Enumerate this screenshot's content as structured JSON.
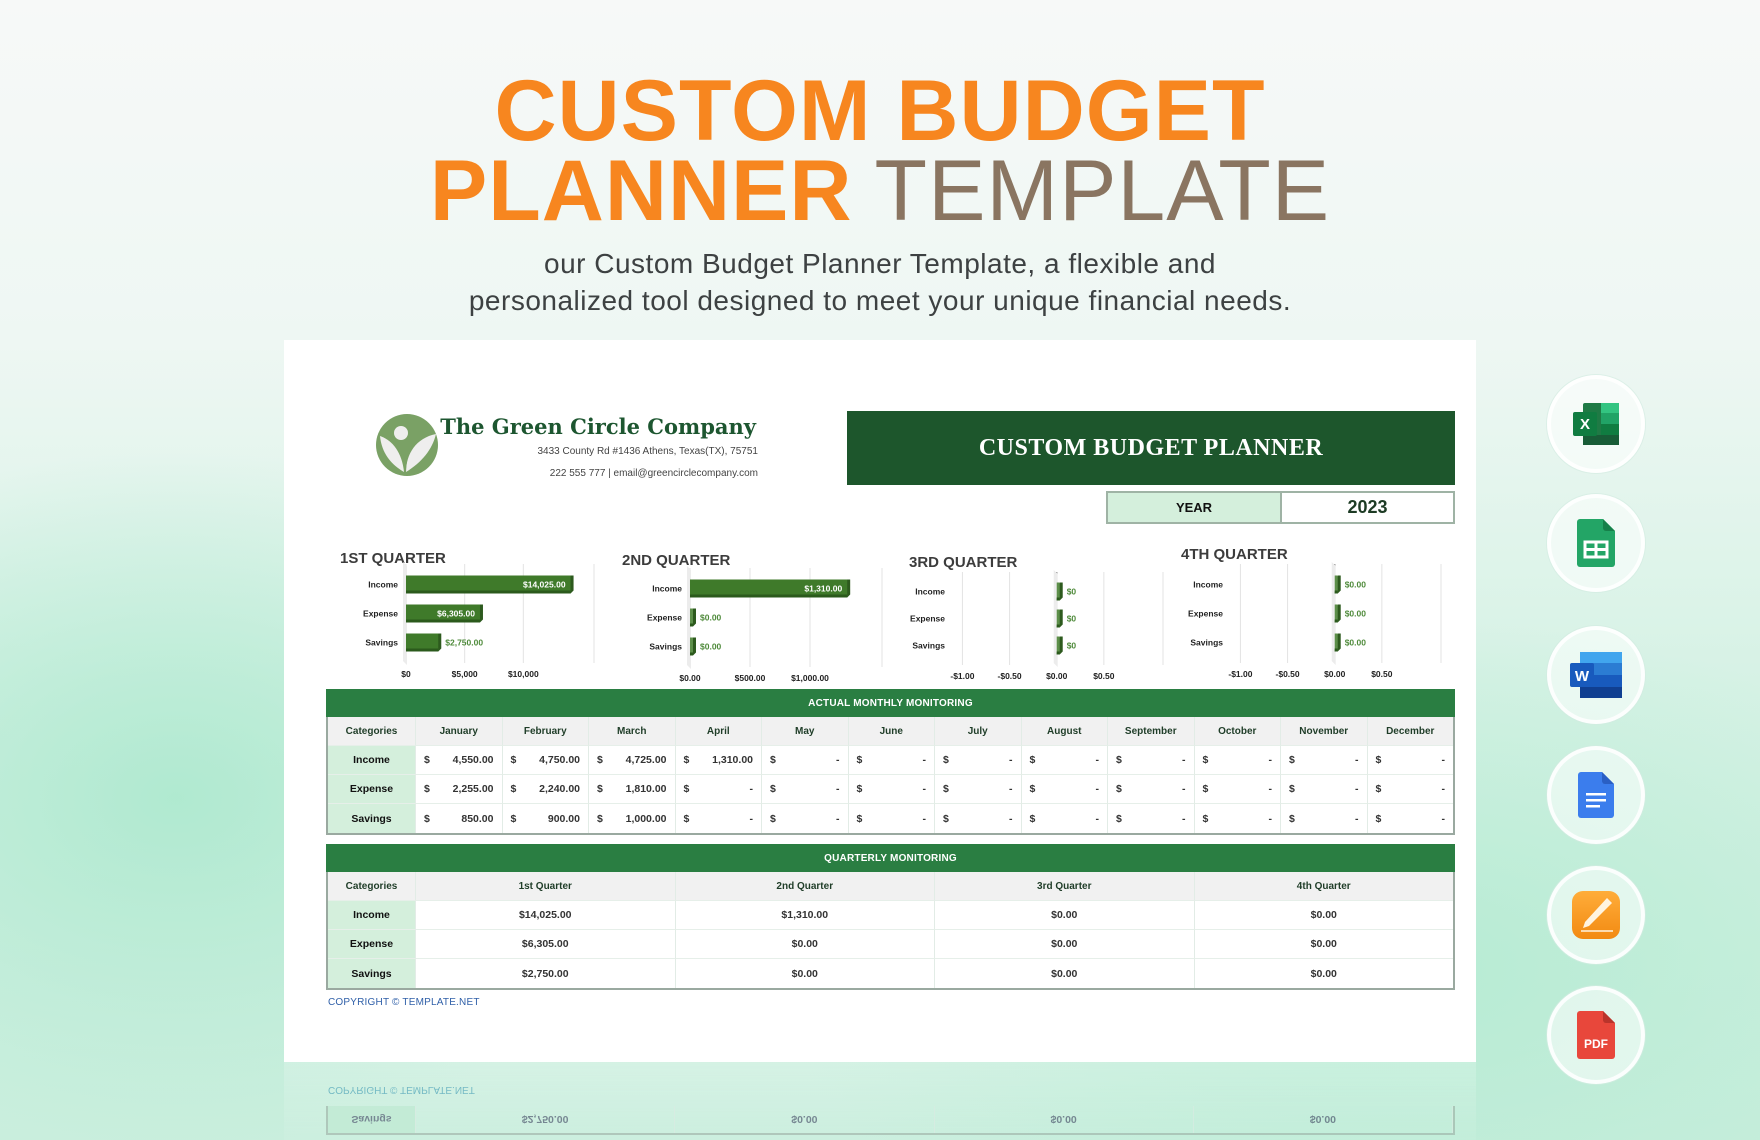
{
  "hero": {
    "title_line1": "CUSTOM BUDGET",
    "title_line2_accent": "PLANNER",
    "title_line2_muted": "TEMPLATE",
    "subtitle_line1": "our Custom Budget Planner Template, a flexible and",
    "subtitle_line2": "personalized tool designed to meet your unique financial needs."
  },
  "company": {
    "name": "The Green Circle Company",
    "address": "3433 County Rd #1436 Athens, Texas(TX), 75751",
    "contact": "222 555 777  |  email@greencirclecompany.com",
    "logo_icon": "leaf-sprout-logo-icon"
  },
  "banner": {
    "title": "CUSTOM BUDGET PLANNER",
    "year_label": "YEAR",
    "year_value": "2023"
  },
  "colors": {
    "brand_dark_green": "#1d562c",
    "table_header_green": "#2a7e42",
    "category_cell_mint": "#d4efdc",
    "bar_green": "#3f7a2a",
    "hero_orange": "#f7861f",
    "hero_brown": "#8a7561",
    "copyright_blue": "#2f5fa8"
  },
  "chart_data": [
    {
      "type": "bar",
      "orientation": "horizontal",
      "title": "1ST QUARTER",
      "categories": [
        "Income",
        "Expense",
        "Savings"
      ],
      "values": [
        14025,
        6305,
        2750
      ],
      "value_labels": [
        "$14,025.00",
        "$6,305.00",
        "$2,750.00"
      ],
      "xlim": [
        0,
        15000
      ],
      "xticks": [
        0,
        5000,
        10000
      ],
      "xtick_labels": [
        "$0",
        "$5,000",
        "$10,000"
      ],
      "grid": true
    },
    {
      "type": "bar",
      "orientation": "horizontal",
      "title": "2ND QUARTER",
      "categories": [
        "Income",
        "Expense",
        "Savings"
      ],
      "values": [
        1310,
        0,
        0
      ],
      "value_labels": [
        "$1,310.00",
        "$0.00",
        "$0.00"
      ],
      "xlim": [
        0,
        1500
      ],
      "xticks": [
        0,
        500,
        1000
      ],
      "xtick_labels": [
        "$0.00",
        "$500.00",
        "$1,000.00"
      ],
      "grid": true
    },
    {
      "type": "bar",
      "orientation": "horizontal",
      "title": "3RD QUARTER",
      "categories": [
        "Income",
        "Expense",
        "Savings"
      ],
      "values": [
        0,
        0,
        0
      ],
      "value_labels": [
        "$0",
        "$0",
        "$0"
      ],
      "xlim": [
        -1.1,
        1.0
      ],
      "xticks": [
        -1.0,
        -0.5,
        0,
        0.5
      ],
      "xtick_labels": [
        "-$1.00",
        "-$0.50",
        "$0.00",
        "$0.50"
      ],
      "grid": true
    },
    {
      "type": "bar",
      "orientation": "horizontal",
      "title": "4TH QUARTER",
      "categories": [
        "Income",
        "Expense",
        "Savings"
      ],
      "values": [
        0,
        0,
        0
      ],
      "value_labels": [
        "$0.00",
        "$0.00",
        "$0.00"
      ],
      "xlim": [
        -1.1,
        1.0
      ],
      "xticks": [
        -1.0,
        -0.5,
        0,
        0.5
      ],
      "xtick_labels": [
        "-$1.00",
        "-$0.50",
        "$0.00",
        "$0.50"
      ],
      "grid": true
    }
  ],
  "monthly": {
    "title": "ACTUAL MONTHLY MONITORING",
    "category_header": "Categories",
    "currency": "$",
    "months": [
      "January",
      "February",
      "March",
      "April",
      "May",
      "June",
      "July",
      "August",
      "September",
      "October",
      "November",
      "December"
    ],
    "rows": [
      {
        "label": "Income",
        "values": [
          "4,550.00",
          "4,750.00",
          "4,725.00",
          "1,310.00",
          "-",
          "-",
          "-",
          "-",
          "-",
          "-",
          "-",
          "-"
        ]
      },
      {
        "label": "Expense",
        "values": [
          "2,255.00",
          "2,240.00",
          "1,810.00",
          "-",
          "-",
          "-",
          "-",
          "-",
          "-",
          "-",
          "-",
          "-"
        ]
      },
      {
        "label": "Savings",
        "values": [
          "850.00",
          "900.00",
          "1,000.00",
          "-",
          "-",
          "-",
          "-",
          "-",
          "-",
          "-",
          "-",
          "-"
        ]
      }
    ]
  },
  "quarterly": {
    "title": "QUARTERLY MONITORING",
    "category_header": "Categories",
    "quarters": [
      "1st Quarter",
      "2nd Quarter",
      "3rd Quarter",
      "4th Quarter"
    ],
    "rows": [
      {
        "label": "Income",
        "values": [
          "$14,025.00",
          "$1,310.00",
          "$0.00",
          "$0.00"
        ]
      },
      {
        "label": "Expense",
        "values": [
          "$6,305.00",
          "$0.00",
          "$0.00",
          "$0.00"
        ]
      },
      {
        "label": "Savings",
        "values": [
          "$2,750.00",
          "$0.00",
          "$0.00",
          "$0.00"
        ]
      }
    ]
  },
  "copyright": "COPYRIGHT © TEMPLATE.NET",
  "formats": [
    {
      "name": "Microsoft Excel",
      "icon": "excel-icon"
    },
    {
      "name": "Google Sheets",
      "icon": "google-sheets-icon"
    },
    {
      "name": "Microsoft Word",
      "icon": "word-icon"
    },
    {
      "name": "Google Docs",
      "icon": "google-docs-icon"
    },
    {
      "name": "Apple Pages",
      "icon": "apple-pages-icon"
    },
    {
      "name": "PDF",
      "icon": "pdf-icon",
      "label": "PDF"
    }
  ]
}
